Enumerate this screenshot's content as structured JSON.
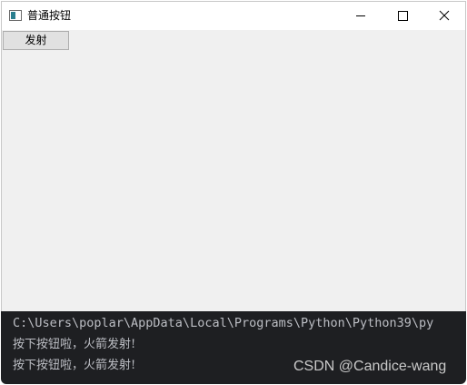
{
  "window": {
    "title": "普通按钮",
    "controls": {
      "minimize": "minimize-icon",
      "maximize": "maximize-icon",
      "close": "close-icon"
    }
  },
  "main": {
    "fire_button_label": "发射"
  },
  "console": {
    "path": "C:\\Users\\poplar\\AppData\\Local\\Programs\\Python\\Python39\\py",
    "lines": [
      "按下按钮啦，火箭发射!",
      "按下按钮啦，火箭发射!"
    ],
    "watermark": "CSDN @Candice-wang"
  },
  "colors": {
    "window_bg": "#f0f0f0",
    "titlebar_bg": "#ffffff",
    "button_bg": "#e1e1e1",
    "console_bg": "#1e1f22",
    "console_text": "#bcbec4"
  }
}
